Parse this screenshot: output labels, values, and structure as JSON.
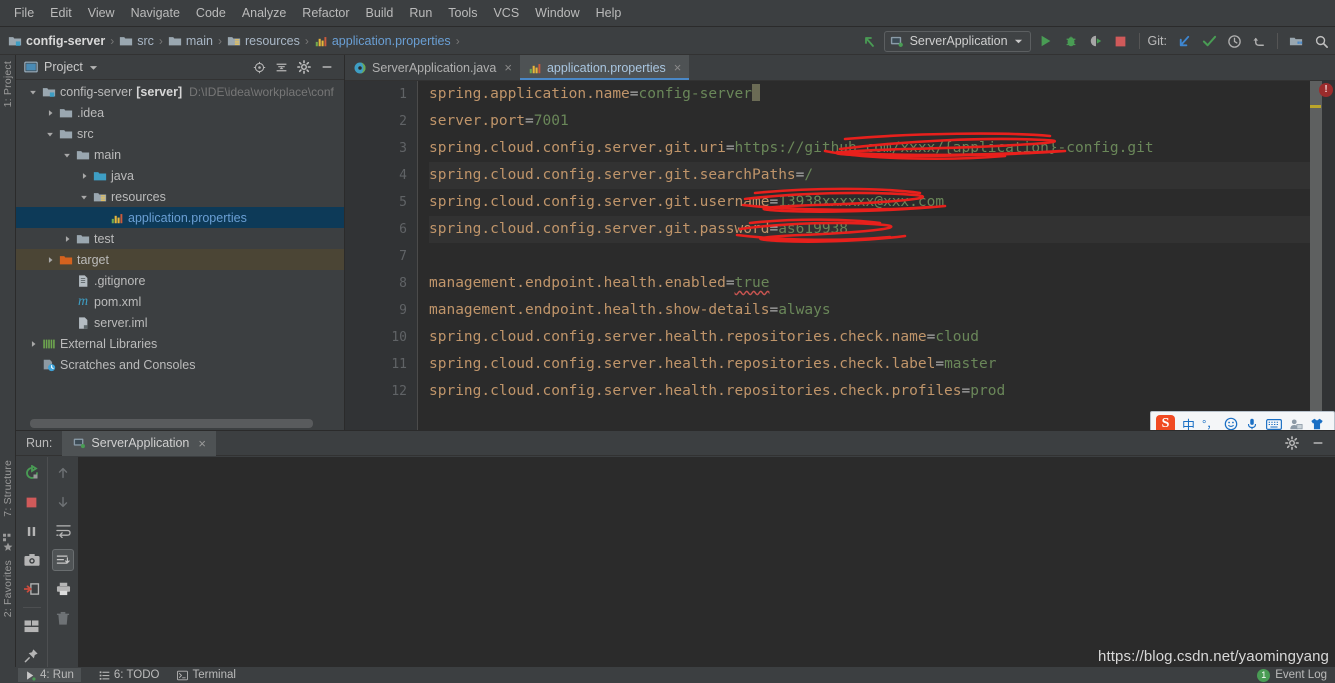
{
  "menu": {
    "items": [
      "File",
      "Edit",
      "View",
      "Navigate",
      "Code",
      "Analyze",
      "Refactor",
      "Build",
      "Run",
      "Tools",
      "VCS",
      "Window",
      "Help"
    ]
  },
  "breadcrumb": {
    "items": [
      {
        "label": "config-server",
        "style": "bold",
        "icon": "module-icon"
      },
      {
        "label": "src",
        "style": "normal",
        "icon": "folder-icon"
      },
      {
        "label": "main",
        "style": "normal",
        "icon": "folder-icon"
      },
      {
        "label": "resources",
        "style": "normal",
        "icon": "resources-folder-icon"
      },
      {
        "label": "application.properties",
        "style": "blue",
        "icon": "properties-file-icon"
      }
    ],
    "separator": "›"
  },
  "toolbar": {
    "run_config_name": "ServerApplication",
    "git_label": "Git:",
    "icons": [
      "back-arrow-icon",
      "run-icon",
      "debug-icon",
      "run-with-coverage-icon",
      "stop-icon",
      "update-project-icon",
      "commit-icon",
      "history-icon",
      "rollback-icon",
      "vcs-group-icon"
    ]
  },
  "project_panel": {
    "title": "Project",
    "vertical_label": "1: Project",
    "header_icons": [
      "locate-icon",
      "collapse-all-icon",
      "settings-gear-icon",
      "minimize-icon"
    ],
    "tree": [
      {
        "indent": 0,
        "arrow": "down",
        "icon": "module-icon",
        "label": "config-server",
        "bold_suffix": "[server]",
        "path": "D:\\IDE\\idea\\workplace\\conf",
        "state": "normal"
      },
      {
        "indent": 1,
        "arrow": "right",
        "icon": "folder-icon",
        "label": ".idea",
        "state": "normal"
      },
      {
        "indent": 1,
        "arrow": "down",
        "icon": "folder-icon",
        "label": "src",
        "state": "normal"
      },
      {
        "indent": 2,
        "arrow": "down",
        "icon": "folder-icon",
        "label": "main",
        "state": "normal"
      },
      {
        "indent": 3,
        "arrow": "right",
        "icon": "source-folder-icon",
        "label": "java",
        "state": "normal"
      },
      {
        "indent": 3,
        "arrow": "down",
        "icon": "resources-folder-icon",
        "label": "resources",
        "state": "normal"
      },
      {
        "indent": 4,
        "arrow": "none",
        "icon": "properties-file-icon",
        "label": "application.properties",
        "state": "selected"
      },
      {
        "indent": 2,
        "arrow": "right",
        "icon": "folder-icon",
        "label": "test",
        "state": "normal"
      },
      {
        "indent": 1,
        "arrow": "right",
        "icon": "target-folder-icon",
        "label": "target",
        "state": "target"
      },
      {
        "indent": 2,
        "arrow": "none",
        "icon": "gitignore-file-icon",
        "label": ".gitignore",
        "state": "normal"
      },
      {
        "indent": 2,
        "arrow": "none",
        "icon": "maven-file-icon",
        "label": "pom.xml",
        "state": "normal"
      },
      {
        "indent": 2,
        "arrow": "none",
        "icon": "iml-file-icon",
        "label": "server.iml",
        "state": "normal"
      },
      {
        "indent": 0,
        "arrow": "right",
        "icon": "libraries-icon",
        "label": "External Libraries",
        "state": "normal"
      },
      {
        "indent": 0,
        "arrow": "none",
        "icon": "scratches-icon",
        "label": "Scratches and Consoles",
        "state": "normal"
      }
    ]
  },
  "editor": {
    "tabs": [
      {
        "label": "ServerApplication.java",
        "icon": "java-class-icon",
        "active": false
      },
      {
        "label": "application.properties",
        "icon": "properties-file-icon",
        "active": true
      }
    ],
    "close_glyph": "×",
    "line_numbers": [
      "1",
      "2",
      "3",
      "4",
      "5",
      "6",
      "7",
      "8",
      "9",
      "10",
      "11",
      "12"
    ],
    "lines": [
      {
        "num": "1",
        "key": "spring.application.name",
        "eq": "=",
        "value": "config-server",
        "caret": true,
        "highlight": false
      },
      {
        "num": "2",
        "key": "server.port",
        "eq": "=",
        "value": "7001",
        "highlight": false
      },
      {
        "num": "3",
        "key": "spring.cloud.config.server.git.uri",
        "eq": "=",
        "value": "https://github.com/xxxx/{application}-config.git",
        "highlight": false,
        "redacted": true
      },
      {
        "num": "4",
        "key": "spring.cloud.config.server.git.searchPaths",
        "eq": "=",
        "value": "/",
        "highlight": true
      },
      {
        "num": "5",
        "key": "spring.cloud.config.server.git.username",
        "eq": "=",
        "value": "13938xxxxxx@xxx.com",
        "highlight": false,
        "redacted": true
      },
      {
        "num": "6",
        "key": "spring.cloud.config.server.git.password",
        "eq": "=",
        "value": "as619938",
        "highlight": true,
        "redacted": true
      },
      {
        "num": "7",
        "key": "",
        "eq": "",
        "value": "",
        "highlight": false
      },
      {
        "num": "8",
        "key": "management.endpoint.health.enabled",
        "eq": "=",
        "value": "true",
        "spellerror": true,
        "highlight": false
      },
      {
        "num": "9",
        "key": "management.endpoint.health.show-details",
        "eq": "=",
        "value": "always",
        "highlight": false
      },
      {
        "num": "10",
        "key": "spring.cloud.config.server.health.repositories.check.name",
        "eq": "=",
        "value": "cloud",
        "highlight": false
      },
      {
        "num": "11",
        "key": "spring.cloud.config.server.health.repositories.check.label",
        "eq": "=",
        "value": "master",
        "highlight": false
      },
      {
        "num": "12",
        "key": "spring.cloud.config.server.health.repositories.check.profiles",
        "eq": "=",
        "value": "prod",
        "highlight": false
      }
    ],
    "error_badge": "!"
  },
  "ime": {
    "logo": "S",
    "items": [
      "中",
      "°，",
      "☺",
      "mic-icon",
      "keyboard-icon",
      "user-card-icon",
      "skin-icon"
    ]
  },
  "run_panel": {
    "label": "Run:",
    "tab": "ServerApplication",
    "close_glyph": "×",
    "header_icons": [
      "settings-gear-icon",
      "minimize-icon"
    ],
    "vertical_labels": [
      "7: Structure",
      "2: Favorites"
    ],
    "toolbar_col1": [
      "rerun-icon",
      "stop-icon",
      "pause-icon",
      "camera-icon",
      "export-icon",
      "layout-icon",
      "pin-icon"
    ],
    "toolbar_col2": [
      "up-arrow-icon",
      "down-arrow-icon",
      "soft-wrap-icon",
      "scroll-to-end-icon",
      "print-icon",
      "trash-icon"
    ],
    "console_text": ""
  },
  "statusbar": {
    "items": [
      {
        "label": "4: Run",
        "icon": "run-icon",
        "active": true
      },
      {
        "label": "6: TODO",
        "icon": "todo-icon",
        "active": false
      },
      {
        "label": "Terminal",
        "icon": "terminal-icon",
        "active": false
      }
    ],
    "event_log": {
      "count": "1",
      "label": "Event Log"
    }
  },
  "watermark": "https://blog.csdn.net/yaomingyang",
  "colors": {
    "panel_bg": "#3c3f41",
    "editor_bg": "#2b2b2b",
    "selection_blue": "#0d3a58",
    "key_orange": "#c0956a",
    "value_green": "#6a8759",
    "accent_blue": "#6a9fd4",
    "redaction_red": "#e8201c",
    "target_brown": "#4b4535"
  }
}
